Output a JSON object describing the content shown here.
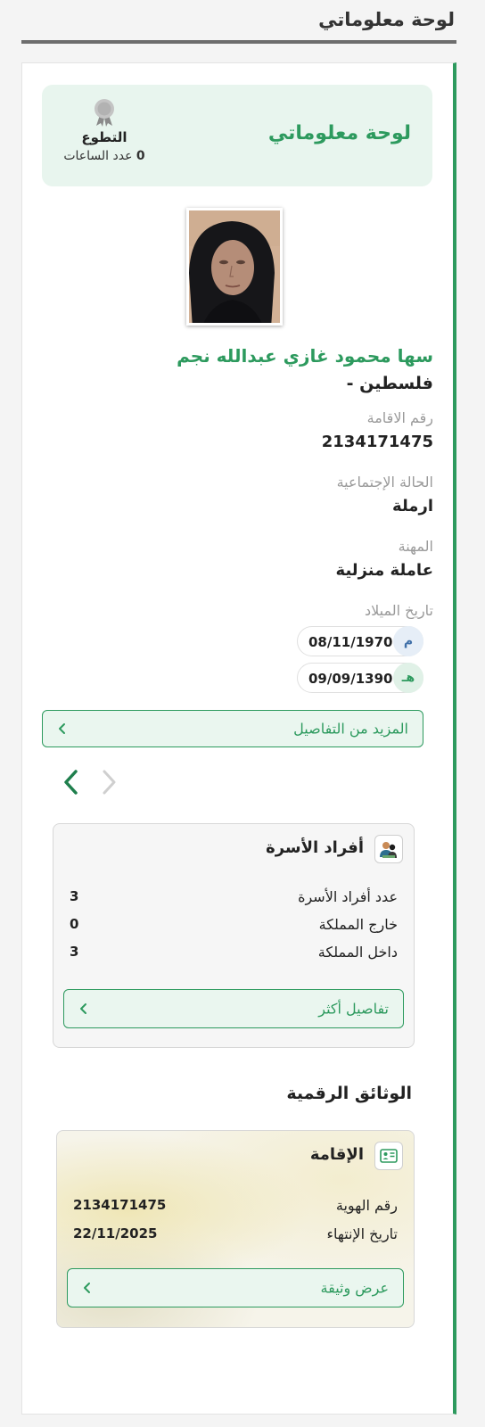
{
  "header": {
    "title": "لوحة معلوماتي"
  },
  "dashboard": {
    "title": "لوحة معلوماتي",
    "volunteer": {
      "title": "التطوع",
      "hours_value": "0",
      "hours_label": "عدد الساعات"
    }
  },
  "profile": {
    "name": "سها محمود غازي عبدالله نجم",
    "nationality": "فلسطين -",
    "residence_number": {
      "label": "رقم الاقامة",
      "value": "2134171475"
    },
    "marital_status": {
      "label": "الحالة الإجتماعية",
      "value": "ارملة"
    },
    "occupation": {
      "label": "المهنة",
      "value": "عاملة منزلية"
    },
    "birth_date": {
      "label": "تاريخ الميلاد",
      "gregorian": {
        "type": "م",
        "value": "08/11/1970"
      },
      "hijri": {
        "type": "هـ",
        "value": "09/09/1390"
      }
    },
    "more_details_label": "المزيد من التفاصيل"
  },
  "family_card": {
    "title": "أفراد الأسرة",
    "rows": [
      {
        "label": "عدد أفراد الأسرة",
        "value": "3"
      },
      {
        "label": "خارج المملكة",
        "value": "0"
      },
      {
        "label": "داخل المملكة",
        "value": "3"
      }
    ],
    "button_label": "تفاصيل أكثر"
  },
  "digital_documents": {
    "title": "الوثائق الرقمية",
    "iqama": {
      "title": "الإقامة",
      "rows": [
        {
          "label": "رقم الهوية",
          "value": "2134171475"
        },
        {
          "label": "تاريخ الإنتهاء",
          "value": "22/11/2025"
        }
      ],
      "button_label": "عرض وثيقة"
    }
  },
  "colors": {
    "accent": "#2d9a5e",
    "accent_light": "#e8f5ee",
    "muted_text": "#9a9a9a"
  }
}
